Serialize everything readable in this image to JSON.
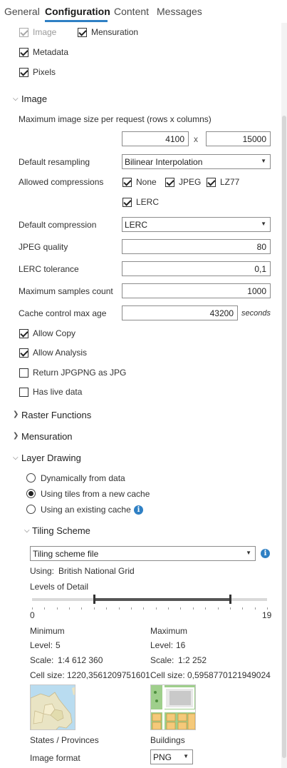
{
  "tabs": [
    {
      "label": "General",
      "active": false
    },
    {
      "label": "Configuration",
      "active": true
    },
    {
      "label": "Content",
      "active": false
    },
    {
      "label": "Messages",
      "active": false
    }
  ],
  "capabilities": {
    "image": {
      "label": "Image",
      "checked": true,
      "disabled": true
    },
    "mensuration": {
      "label": "Mensuration",
      "checked": true
    },
    "metadata": {
      "label": "Metadata",
      "checked": true
    },
    "pixels": {
      "label": "Pixels",
      "checked": true
    }
  },
  "image_section": {
    "title": "Image",
    "max_size_label": "Maximum image size per request (rows x columns)",
    "rows": "4100",
    "x_label": "x",
    "columns": "15000",
    "resampling_label": "Default resampling",
    "resampling_value": "Bilinear Interpolation",
    "allowed_compressions_label": "Allowed compressions",
    "compressions": {
      "none": {
        "label": "None",
        "checked": true
      },
      "jpeg": {
        "label": "JPEG",
        "checked": true
      },
      "lz77": {
        "label": "LZ77",
        "checked": true
      },
      "lerc": {
        "label": "LERC",
        "checked": true
      }
    },
    "default_compression_label": "Default compression",
    "default_compression_value": "LERC",
    "jpeg_quality_label": "JPEG quality",
    "jpeg_quality_value": "80",
    "lerc_tolerance_label": "LERC tolerance",
    "lerc_tolerance_value": "0,1",
    "max_samples_label": "Maximum samples count",
    "max_samples_value": "1000",
    "cache_age_label": "Cache control max age",
    "cache_age_value": "43200",
    "cache_age_unit": "seconds",
    "allow_copy": {
      "label": "Allow Copy",
      "checked": true
    },
    "allow_analysis": {
      "label": "Allow Analysis",
      "checked": true
    },
    "return_jpgpng": {
      "label": "Return JPGPNG as JPG",
      "checked": false
    },
    "has_live_data": {
      "label": "Has live data",
      "checked": false
    }
  },
  "sections": {
    "raster_functions": "Raster Functions",
    "mensuration": "Mensuration",
    "layer_drawing": "Layer Drawing"
  },
  "layer_drawing": {
    "options": [
      {
        "label": "Dynamically from data",
        "selected": false
      },
      {
        "label": "Using tiles from a new cache",
        "selected": true
      },
      {
        "label": "Using an existing cache",
        "selected": false
      }
    ]
  },
  "tiling_scheme": {
    "title": "Tiling Scheme",
    "select_value": "Tiling scheme file",
    "using_label": "Using:",
    "using_value": "British National Grid",
    "levels_label": "Levels of Detail",
    "slider_min_label": "0",
    "slider_max_label": "19",
    "range": {
      "min_level": 5,
      "max_level": 16,
      "scale_max": 19
    },
    "minimum": {
      "header": "Minimum",
      "level_label": "Level:",
      "level": "5",
      "scale_label": "Scale:",
      "scale": "1:4 612 360",
      "cell_label": "Cell size:",
      "cell": "1220,3561209751601",
      "caption": "States / Provinces"
    },
    "maximum": {
      "header": "Maximum",
      "level_label": "Level:",
      "level": "16",
      "scale_label": "Scale:",
      "scale": "1:2 252",
      "cell_label": "Cell size:",
      "cell": "0,5958770121949024",
      "caption": "Buildings"
    },
    "image_format_label": "Image format",
    "image_format_value": "PNG"
  },
  "colors": {
    "accent": "#2f80c4",
    "map_water": "#b9dcf0",
    "map_land": "#e9e4c4",
    "map_green": "#9fcf8c",
    "map_building": "#f5c97a"
  }
}
